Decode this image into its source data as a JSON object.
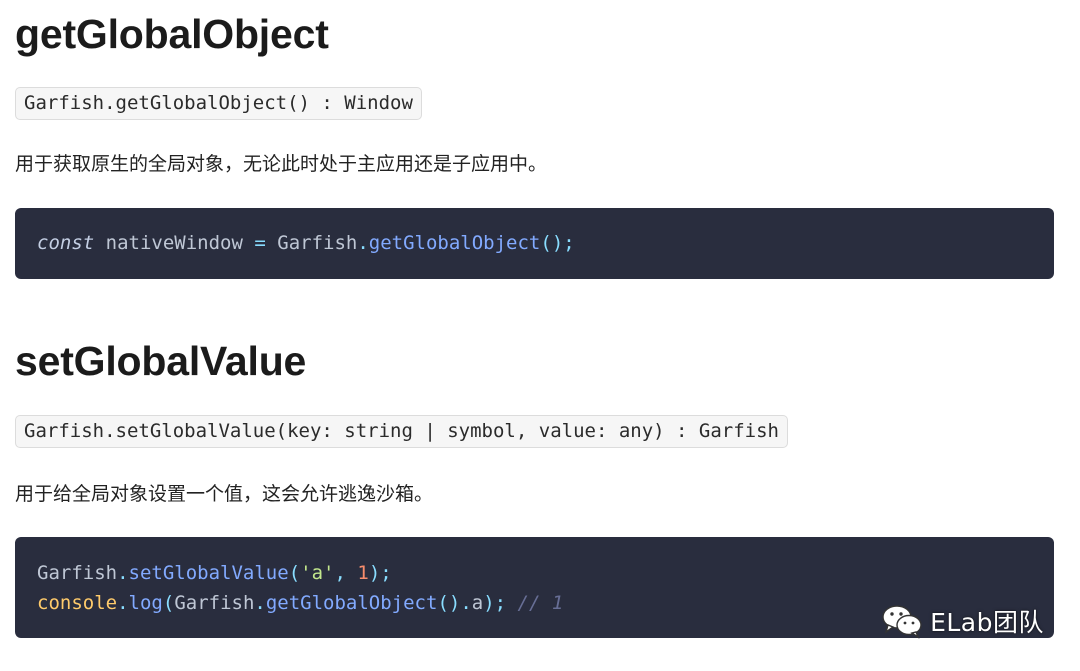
{
  "sections": [
    {
      "heading": "getGlobalObject",
      "signature": "Garfish.getGlobalObject() : Window",
      "description": "用于获取原生的全局对象，无论此时处于主应用还是子应用中。",
      "code_lines": [
        [
          {
            "t": "const",
            "c": "kw"
          },
          {
            "t": " nativeWindow ",
            "c": "id"
          },
          {
            "t": "=",
            "c": "op"
          },
          {
            "t": " Garfish",
            "c": "id"
          },
          {
            "t": ".",
            "c": "op"
          },
          {
            "t": "getGlobalObject",
            "c": "fn"
          },
          {
            "t": "();",
            "c": "op"
          }
        ]
      ]
    },
    {
      "heading": "setGlobalValue",
      "signature": "Garfish.setGlobalValue(key: string | symbol, value: any) : Garfish",
      "description": "用于给全局对象设置一个值，这会允许逃逸沙箱。",
      "code_lines": [
        [
          {
            "t": "Garfish",
            "c": "id"
          },
          {
            "t": ".",
            "c": "op"
          },
          {
            "t": "setGlobalValue",
            "c": "fn"
          },
          {
            "t": "(",
            "c": "op"
          },
          {
            "t": "'a'",
            "c": "str"
          },
          {
            "t": ", ",
            "c": "op"
          },
          {
            "t": "1",
            "c": "num"
          },
          {
            "t": ");",
            "c": "op"
          }
        ],
        [
          {
            "t": "console",
            "c": "glob"
          },
          {
            "t": ".",
            "c": "op"
          },
          {
            "t": "log",
            "c": "fn"
          },
          {
            "t": "(",
            "c": "op"
          },
          {
            "t": "Garfish",
            "c": "id"
          },
          {
            "t": ".",
            "c": "op"
          },
          {
            "t": "getGlobalObject",
            "c": "fn"
          },
          {
            "t": "().",
            "c": "op"
          },
          {
            "t": "a",
            "c": "id"
          },
          {
            "t": ");",
            "c": "op"
          },
          {
            "t": " // 1",
            "c": "cmt"
          }
        ]
      ]
    }
  ],
  "watermark": {
    "icon": "wechat-icon",
    "text": "ELab团队"
  }
}
